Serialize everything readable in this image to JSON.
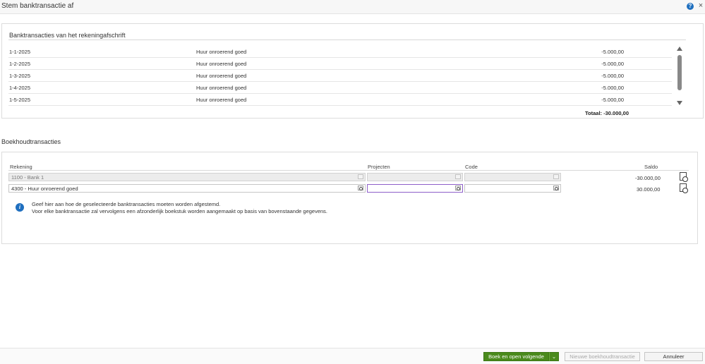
{
  "window": {
    "title": "Stem banktransactie af",
    "help": "?",
    "close": "×"
  },
  "bank_section": {
    "title": "Banktransacties van het rekeningafschrift",
    "rows": [
      {
        "date": "1-1-2025",
        "description": "Huur onroerend goed",
        "amount": "-5.000,00"
      },
      {
        "date": "1-2-2025",
        "description": "Huur onroerend goed",
        "amount": "-5.000,00"
      },
      {
        "date": "1-3-2025",
        "description": "Huur onroerend goed",
        "amount": "-5.000,00"
      },
      {
        "date": "1-4-2025",
        "description": "Huur onroerend goed",
        "amount": "-5.000,00"
      },
      {
        "date": "1-5-2025",
        "description": "Huur onroerend goed",
        "amount": "-5.000,00"
      }
    ],
    "total": "Totaal: -30.000,00"
  },
  "booking_section": {
    "title": "Boekhoudtransacties",
    "columns": {
      "account": "Rekening",
      "projects": "Projecten",
      "code": "Code",
      "balance": "Saldo"
    },
    "rows": [
      {
        "account": "1100 - Bank 1",
        "projects": "",
        "code": "",
        "balance": "-30.000,00",
        "disabled": true
      },
      {
        "account": "4300 - Huur onroerend goed",
        "projects": "",
        "code": "",
        "balance": "30.000,00",
        "disabled": false
      }
    ],
    "info": {
      "line1": "Geef hier aan hoe de geselecteerde banktransacties moeten worden afgestemd.",
      "line2": "Voor elke banktransactie zal vervolgens een afzonderlijk boekstuk worden aangemaakt op basis van bovenstaande gegevens."
    }
  },
  "footer": {
    "primary": "Boek en open volgende",
    "split": "⌄",
    "new_transaction": "Nieuwe boekhoudtransactie",
    "cancel": "Annuleer"
  },
  "colors": {
    "primary": "#4a8a1c",
    "info": "#1f6fbf",
    "focus": "#8e5fc9"
  }
}
